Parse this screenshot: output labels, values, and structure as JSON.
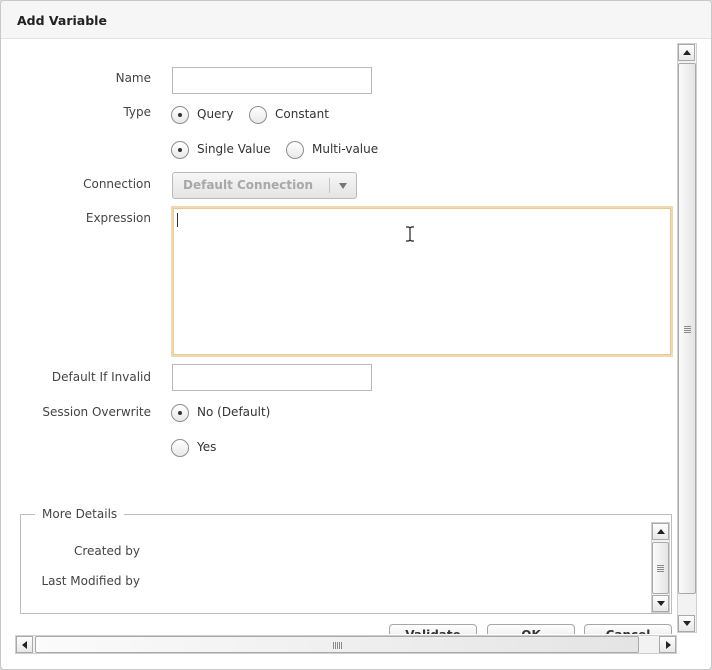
{
  "dialog": {
    "title": "Add Variable"
  },
  "form": {
    "name_label": "Name",
    "name_value": "",
    "type_label": "Type",
    "type_options": [
      "Query",
      "Constant"
    ],
    "type_selected": "Query",
    "value_mode_options": [
      "Single Value",
      "Multi-value"
    ],
    "value_mode_selected": "Single Value",
    "connection_label": "Connection",
    "connection_value": "Default Connection",
    "expression_label": "Expression",
    "expression_value": "",
    "default_if_invalid_label": "Default If Invalid",
    "default_if_invalid_value": "",
    "session_overwrite_label": "Session Overwrite",
    "session_overwrite_options": [
      "No (Default)",
      "Yes"
    ],
    "session_overwrite_selected": "No (Default)"
  },
  "more_details": {
    "legend": "More Details",
    "created_by_label": "Created by",
    "last_modified_by_label": "Last Modified by"
  },
  "buttons": {
    "validate": "Validate",
    "ok": "OK",
    "cancel": "Cancel"
  },
  "icons": {
    "text_cursor": "i-beam-cursor-icon",
    "scroll_up": "arrow-up-icon",
    "scroll_down": "arrow-down-icon",
    "scroll_left": "arrow-left-icon",
    "scroll_right": "arrow-right-icon",
    "dropdown": "chevron-down-icon"
  },
  "colors": {
    "focus_border": "#f0d9b0",
    "dialog_bg": "#ffffff",
    "title_bg": "#f6f6f6"
  }
}
